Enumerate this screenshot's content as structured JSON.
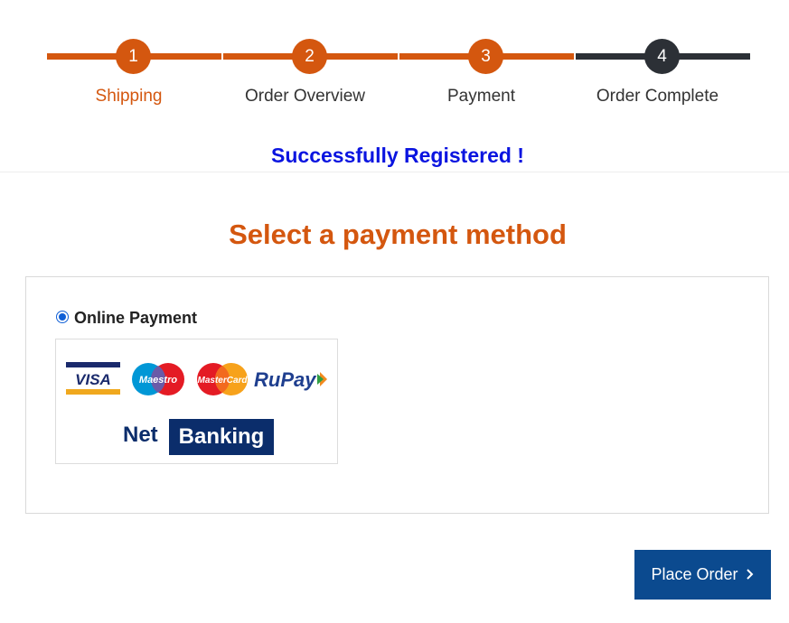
{
  "steps": [
    {
      "number": "1",
      "label": "Shipping",
      "state": "active"
    },
    {
      "number": "2",
      "label": "Order Overview",
      "state": "done"
    },
    {
      "number": "3",
      "label": "Payment",
      "state": "done"
    },
    {
      "number": "4",
      "label": "Order Complete",
      "state": "todo"
    }
  ],
  "success_message": "Successfully Registered !",
  "page_heading": "Select a payment method",
  "payment": {
    "option_label": "Online Payment",
    "selected": true,
    "logos": {
      "visa": "VISA",
      "maestro": "Maestro",
      "mastercard": "MasterCard",
      "rupay": "RuPay",
      "net": "Net",
      "banking": "Banking"
    }
  },
  "actions": {
    "place_order_label": "Place Order",
    "place_order_icon": "chevron-right-icon"
  },
  "colors": {
    "accent": "#d4570f",
    "incomplete": "#2c3036",
    "success_text": "#0a14e0",
    "primary_button": "#0b4a8f"
  }
}
